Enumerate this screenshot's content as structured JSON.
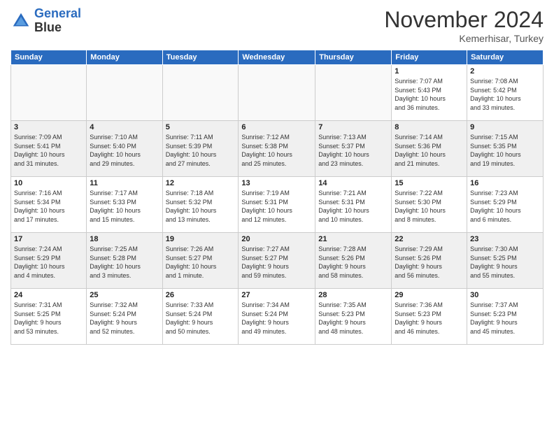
{
  "header": {
    "logo_line1": "General",
    "logo_line2": "Blue",
    "month_title": "November 2024",
    "location": "Kemerhisar, Turkey"
  },
  "weekdays": [
    "Sunday",
    "Monday",
    "Tuesday",
    "Wednesday",
    "Thursday",
    "Friday",
    "Saturday"
  ],
  "weeks": [
    [
      {
        "day": "",
        "info": ""
      },
      {
        "day": "",
        "info": ""
      },
      {
        "day": "",
        "info": ""
      },
      {
        "day": "",
        "info": ""
      },
      {
        "day": "",
        "info": ""
      },
      {
        "day": "1",
        "info": "Sunrise: 7:07 AM\nSunset: 5:43 PM\nDaylight: 10 hours\nand 36 minutes."
      },
      {
        "day": "2",
        "info": "Sunrise: 7:08 AM\nSunset: 5:42 PM\nDaylight: 10 hours\nand 33 minutes."
      }
    ],
    [
      {
        "day": "3",
        "info": "Sunrise: 7:09 AM\nSunset: 5:41 PM\nDaylight: 10 hours\nand 31 minutes."
      },
      {
        "day": "4",
        "info": "Sunrise: 7:10 AM\nSunset: 5:40 PM\nDaylight: 10 hours\nand 29 minutes."
      },
      {
        "day": "5",
        "info": "Sunrise: 7:11 AM\nSunset: 5:39 PM\nDaylight: 10 hours\nand 27 minutes."
      },
      {
        "day": "6",
        "info": "Sunrise: 7:12 AM\nSunset: 5:38 PM\nDaylight: 10 hours\nand 25 minutes."
      },
      {
        "day": "7",
        "info": "Sunrise: 7:13 AM\nSunset: 5:37 PM\nDaylight: 10 hours\nand 23 minutes."
      },
      {
        "day": "8",
        "info": "Sunrise: 7:14 AM\nSunset: 5:36 PM\nDaylight: 10 hours\nand 21 minutes."
      },
      {
        "day": "9",
        "info": "Sunrise: 7:15 AM\nSunset: 5:35 PM\nDaylight: 10 hours\nand 19 minutes."
      }
    ],
    [
      {
        "day": "10",
        "info": "Sunrise: 7:16 AM\nSunset: 5:34 PM\nDaylight: 10 hours\nand 17 minutes."
      },
      {
        "day": "11",
        "info": "Sunrise: 7:17 AM\nSunset: 5:33 PM\nDaylight: 10 hours\nand 15 minutes."
      },
      {
        "day": "12",
        "info": "Sunrise: 7:18 AM\nSunset: 5:32 PM\nDaylight: 10 hours\nand 13 minutes."
      },
      {
        "day": "13",
        "info": "Sunrise: 7:19 AM\nSunset: 5:31 PM\nDaylight: 10 hours\nand 12 minutes."
      },
      {
        "day": "14",
        "info": "Sunrise: 7:21 AM\nSunset: 5:31 PM\nDaylight: 10 hours\nand 10 minutes."
      },
      {
        "day": "15",
        "info": "Sunrise: 7:22 AM\nSunset: 5:30 PM\nDaylight: 10 hours\nand 8 minutes."
      },
      {
        "day": "16",
        "info": "Sunrise: 7:23 AM\nSunset: 5:29 PM\nDaylight: 10 hours\nand 6 minutes."
      }
    ],
    [
      {
        "day": "17",
        "info": "Sunrise: 7:24 AM\nSunset: 5:29 PM\nDaylight: 10 hours\nand 4 minutes."
      },
      {
        "day": "18",
        "info": "Sunrise: 7:25 AM\nSunset: 5:28 PM\nDaylight: 10 hours\nand 3 minutes."
      },
      {
        "day": "19",
        "info": "Sunrise: 7:26 AM\nSunset: 5:27 PM\nDaylight: 10 hours\nand 1 minute."
      },
      {
        "day": "20",
        "info": "Sunrise: 7:27 AM\nSunset: 5:27 PM\nDaylight: 9 hours\nand 59 minutes."
      },
      {
        "day": "21",
        "info": "Sunrise: 7:28 AM\nSunset: 5:26 PM\nDaylight: 9 hours\nand 58 minutes."
      },
      {
        "day": "22",
        "info": "Sunrise: 7:29 AM\nSunset: 5:26 PM\nDaylight: 9 hours\nand 56 minutes."
      },
      {
        "day": "23",
        "info": "Sunrise: 7:30 AM\nSunset: 5:25 PM\nDaylight: 9 hours\nand 55 minutes."
      }
    ],
    [
      {
        "day": "24",
        "info": "Sunrise: 7:31 AM\nSunset: 5:25 PM\nDaylight: 9 hours\nand 53 minutes."
      },
      {
        "day": "25",
        "info": "Sunrise: 7:32 AM\nSunset: 5:24 PM\nDaylight: 9 hours\nand 52 minutes."
      },
      {
        "day": "26",
        "info": "Sunrise: 7:33 AM\nSunset: 5:24 PM\nDaylight: 9 hours\nand 50 minutes."
      },
      {
        "day": "27",
        "info": "Sunrise: 7:34 AM\nSunset: 5:24 PM\nDaylight: 9 hours\nand 49 minutes."
      },
      {
        "day": "28",
        "info": "Sunrise: 7:35 AM\nSunset: 5:23 PM\nDaylight: 9 hours\nand 48 minutes."
      },
      {
        "day": "29",
        "info": "Sunrise: 7:36 AM\nSunset: 5:23 PM\nDaylight: 9 hours\nand 46 minutes."
      },
      {
        "day": "30",
        "info": "Sunrise: 7:37 AM\nSunset: 5:23 PM\nDaylight: 9 hours\nand 45 minutes."
      }
    ]
  ]
}
